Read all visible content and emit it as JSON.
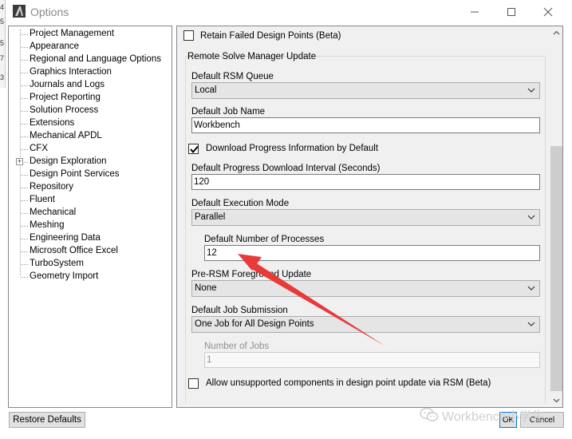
{
  "window": {
    "title": "Options",
    "icon": "ansys-logo-icon"
  },
  "left_strip_chars": [
    "4",
    "5",
    "5",
    "7",
    "3"
  ],
  "tree": {
    "items": [
      {
        "label": "Project Management"
      },
      {
        "label": "Appearance"
      },
      {
        "label": "Regional and Language Options"
      },
      {
        "label": "Graphics Interaction"
      },
      {
        "label": "Journals and Logs"
      },
      {
        "label": "Project Reporting"
      },
      {
        "label": "Solution Process"
      },
      {
        "label": "Extensions"
      },
      {
        "label": "Mechanical APDL"
      },
      {
        "label": "CFX"
      },
      {
        "label": "Design Exploration",
        "expandable": true
      },
      {
        "label": "Design Point Services"
      },
      {
        "label": "Repository"
      },
      {
        "label": "Fluent"
      },
      {
        "label": "Mechanical"
      },
      {
        "label": "Meshing"
      },
      {
        "label": "Engineering Data"
      },
      {
        "label": "Microsoft Office Excel"
      },
      {
        "label": "TurboSystem"
      },
      {
        "label": "Geometry Import"
      }
    ]
  },
  "settings": {
    "retain_failed": {
      "label": "Retain Failed Design Points (Beta)",
      "checked": false
    },
    "rsm_group_title": "Remote Solve Manager Update",
    "default_rsm_queue": {
      "label": "Default RSM Queue",
      "value": "Local"
    },
    "default_job_name": {
      "label": "Default Job Name",
      "value": "Workbench"
    },
    "download_progress": {
      "label": "Download Progress Information by Default",
      "checked": true
    },
    "download_interval": {
      "label": "Default Progress Download Interval (Seconds)",
      "value": "120"
    },
    "execution_mode": {
      "label": "Default Execution Mode",
      "value": "Parallel"
    },
    "num_processes": {
      "label": "Default Number of Processes",
      "value": "12"
    },
    "pre_rsm_update": {
      "label": "Pre-RSM Foreground Update",
      "value": "None"
    },
    "job_submission": {
      "label": "Default Job Submission",
      "value": "One Job for All Design Points"
    },
    "number_of_jobs": {
      "label": "Number of Jobs",
      "value": "1",
      "disabled": true
    },
    "allow_unsupported": {
      "label": "Allow unsupported components in design point update via RSM (Beta)",
      "checked": false
    }
  },
  "buttons": {
    "restore_defaults": "Restore Defaults",
    "ok": "OK",
    "cancel": "Cancel"
  },
  "watermark": {
    "text": "Workbench小学生",
    "icon": "wechat-icon"
  },
  "annotation": {
    "color": "#e8393b",
    "icon": "red-arrow-annotation"
  }
}
